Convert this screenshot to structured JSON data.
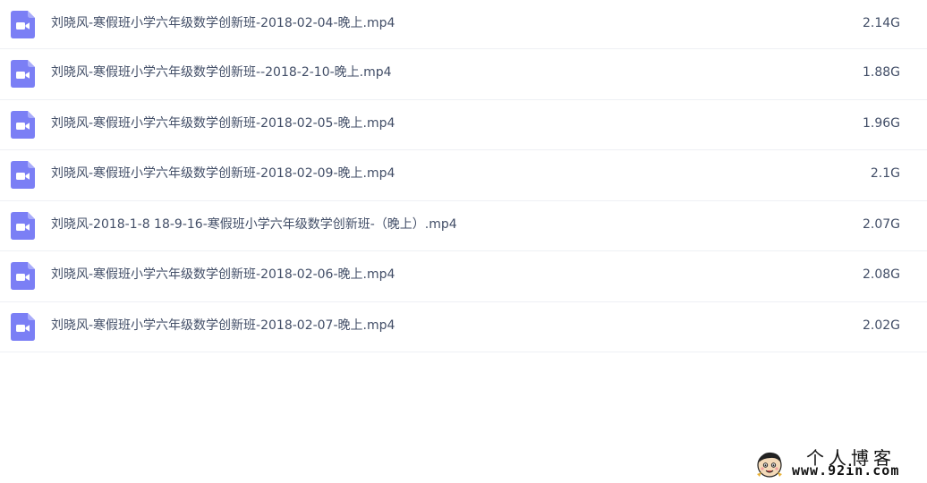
{
  "files": [
    {
      "name": "刘晓风-寒假班小学六年级数学创新班-2018-02-04-晚上.mp4",
      "size": "2.14G",
      "icon": "video-file-icon"
    },
    {
      "name": "刘晓风-寒假班小学六年级数学创新班--2018-2-10-晚上.mp4",
      "size": "1.88G",
      "icon": "video-file-icon"
    },
    {
      "name": "刘晓风-寒假班小学六年级数学创新班-2018-02-05-晚上.mp4",
      "size": "1.96G",
      "icon": "video-file-icon"
    },
    {
      "name": "刘晓风-寒假班小学六年级数学创新班-2018-02-09-晚上.mp4",
      "size": "2.1G",
      "icon": "video-file-icon"
    },
    {
      "name": "刘晓风-2018-1-8 18-9-16-寒假班小学六年级数学创新班-（晚上）.mp4",
      "size": "2.07G",
      "icon": "video-file-icon"
    },
    {
      "name": "刘晓风-寒假班小学六年级数学创新班-2018-02-06-晚上.mp4",
      "size": "2.08G",
      "icon": "video-file-icon"
    },
    {
      "name": "刘晓风-寒假班小学六年级数学创新班-2018-02-07-晚上.mp4",
      "size": "2.02G",
      "icon": "video-file-icon"
    }
  ],
  "watermark": {
    "title": "个人博客",
    "url": "www.92in.com"
  },
  "colors": {
    "icon_accent": "#7b7ff5",
    "text": "#424e67",
    "divider": "#eef0f4"
  }
}
